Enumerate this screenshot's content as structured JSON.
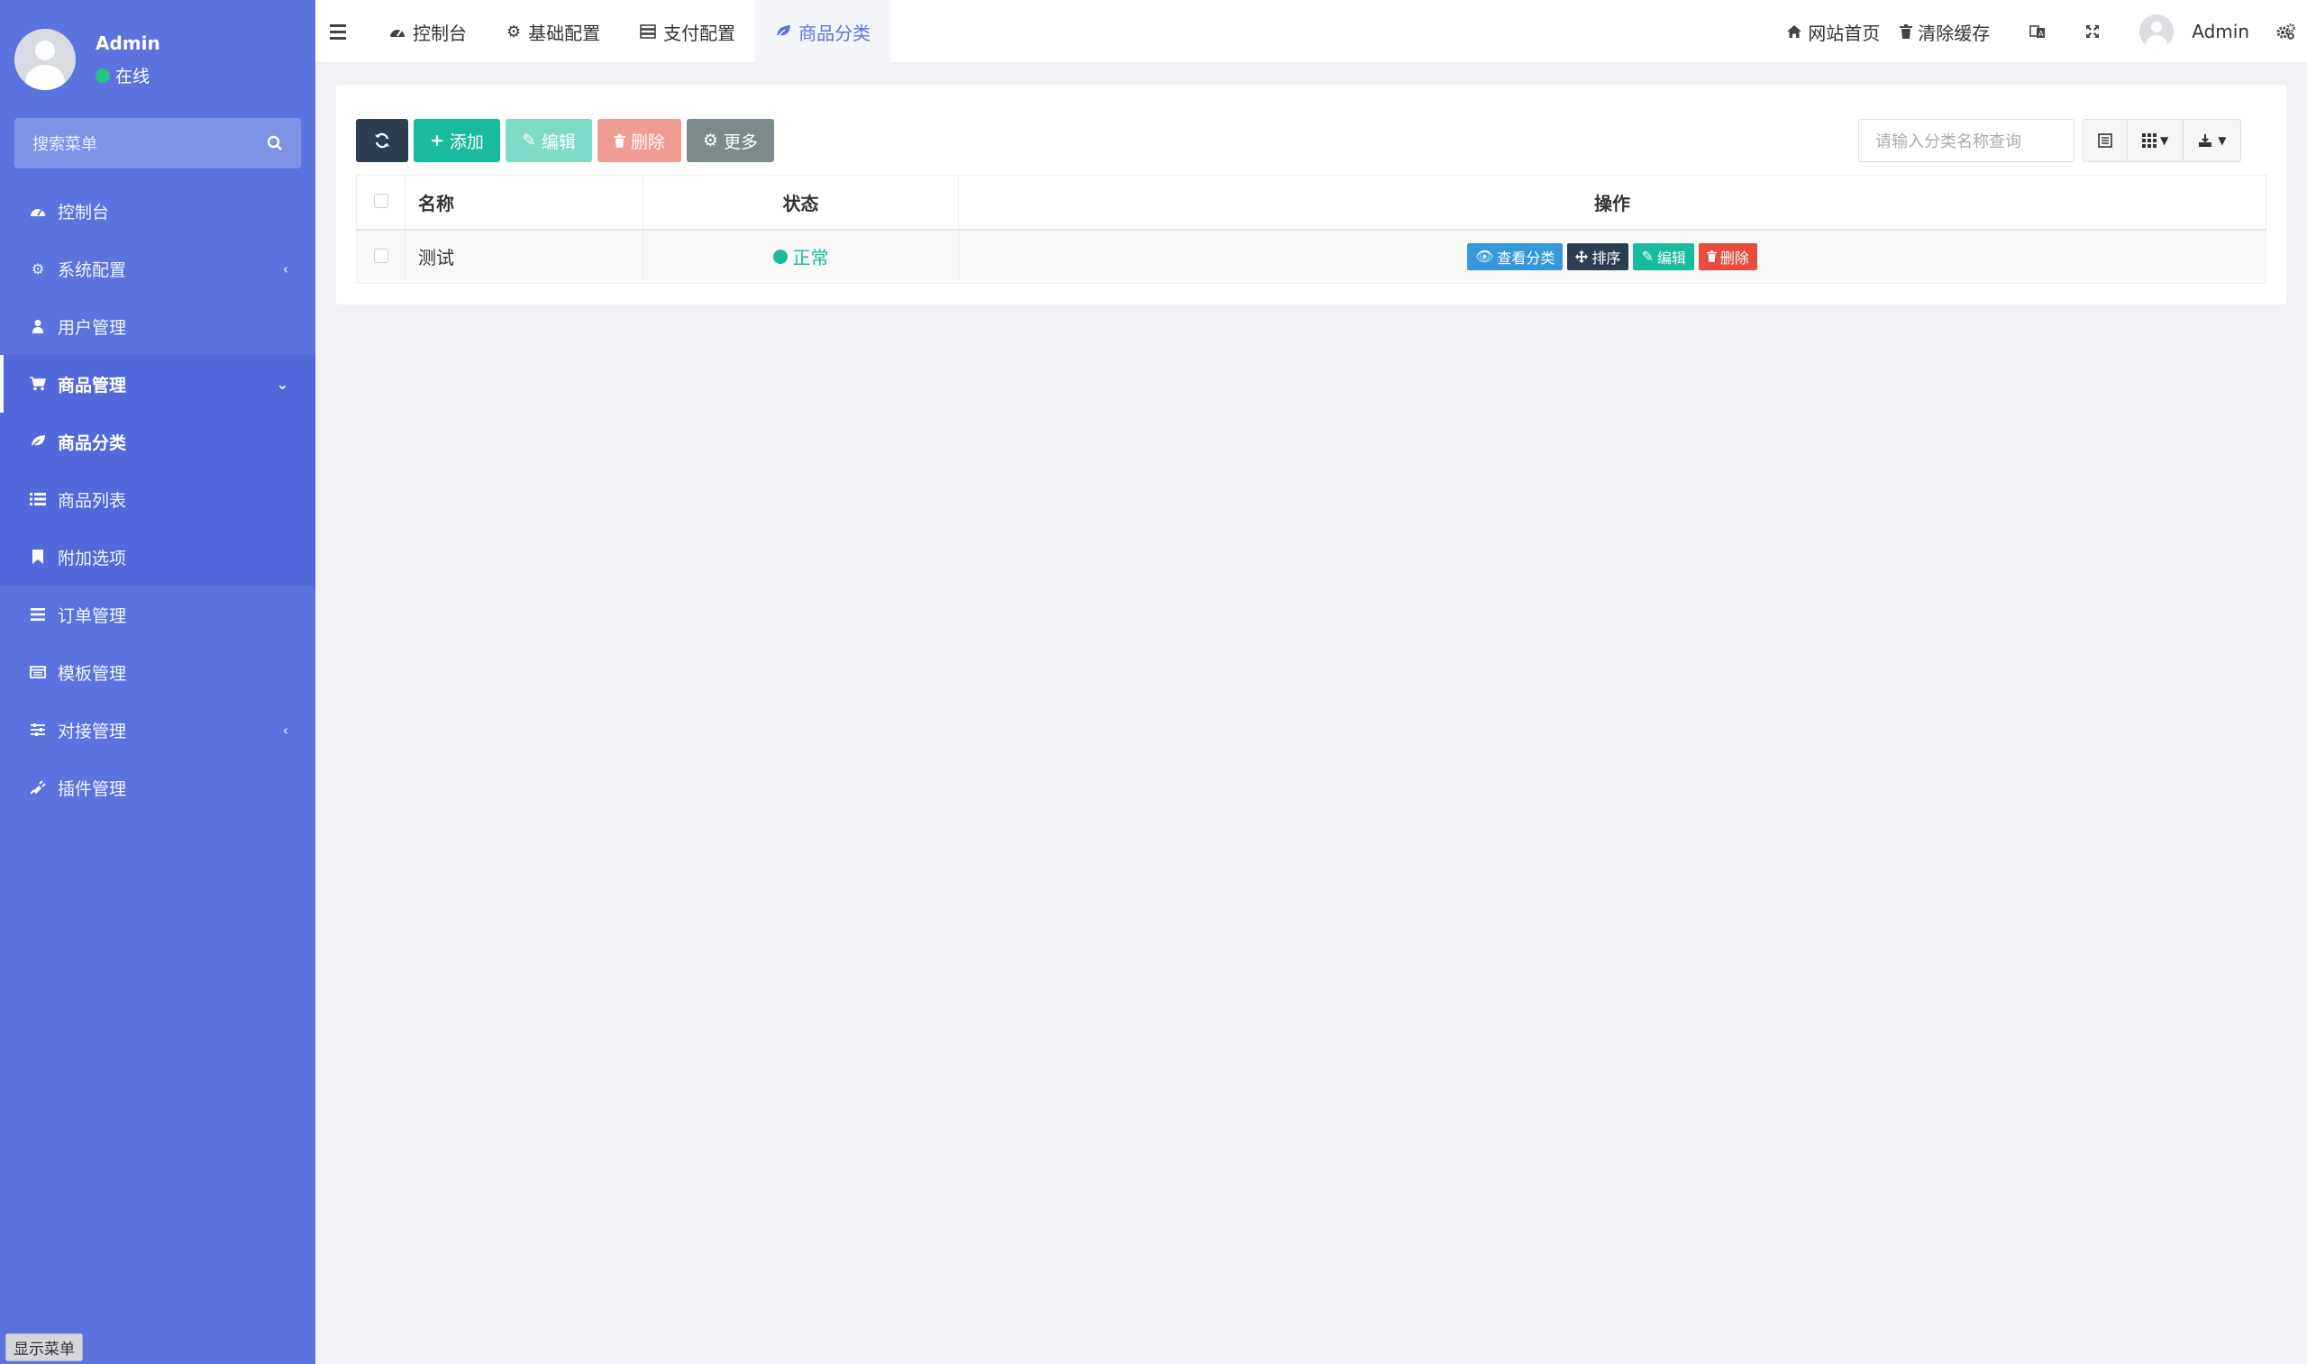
{
  "sidebar": {
    "user": {
      "name": "Admin",
      "status": "在线"
    },
    "search_placeholder": "搜索菜单",
    "items": [
      {
        "label": "控制台",
        "icon": "dashboard-icon"
      },
      {
        "label": "系统配置",
        "icon": "gear-icon"
      },
      {
        "label": "用户管理",
        "icon": "user-icon"
      },
      {
        "label": "商品管理",
        "icon": "cart-icon"
      },
      {
        "label": "商品分类",
        "icon": "leaf-icon"
      },
      {
        "label": "商品列表",
        "icon": "list-icon"
      },
      {
        "label": "附加选项",
        "icon": "bookmark-icon"
      },
      {
        "label": "订单管理",
        "icon": "bars-icon"
      },
      {
        "label": "模板管理",
        "icon": "template-icon"
      },
      {
        "label": "对接管理",
        "icon": "sliders-icon"
      },
      {
        "label": "插件管理",
        "icon": "plug-icon"
      }
    ],
    "show_menu": "显示菜单"
  },
  "topbar": {
    "tabs": [
      {
        "label": "控制台",
        "icon": "dashboard-icon"
      },
      {
        "label": "基础配置",
        "icon": "gear-icon"
      },
      {
        "label": "支付配置",
        "icon": "server-icon"
      },
      {
        "label": "商品分类",
        "icon": "leaf-icon"
      }
    ],
    "home": "网站首页",
    "clear_cache": "清除缓存",
    "user": "Admin"
  },
  "toolbar": {
    "add": "添加",
    "edit": "编辑",
    "delete": "删除",
    "more": "更多",
    "search_placeholder": "请输入分类名称查询"
  },
  "table": {
    "headers": {
      "name": "名称",
      "status": "状态",
      "actions": "操作"
    },
    "rows": [
      {
        "name": "测试",
        "status": "正常",
        "actions": {
          "view": "查看分类",
          "sort": "排序",
          "edit": "编辑",
          "delete": "删除"
        }
      }
    ]
  },
  "colors": {
    "sidebar": "#5b73de",
    "accent": "#5b73de",
    "success": "#18bc9c",
    "danger": "#e74c3c",
    "dark": "#2c3e50"
  }
}
